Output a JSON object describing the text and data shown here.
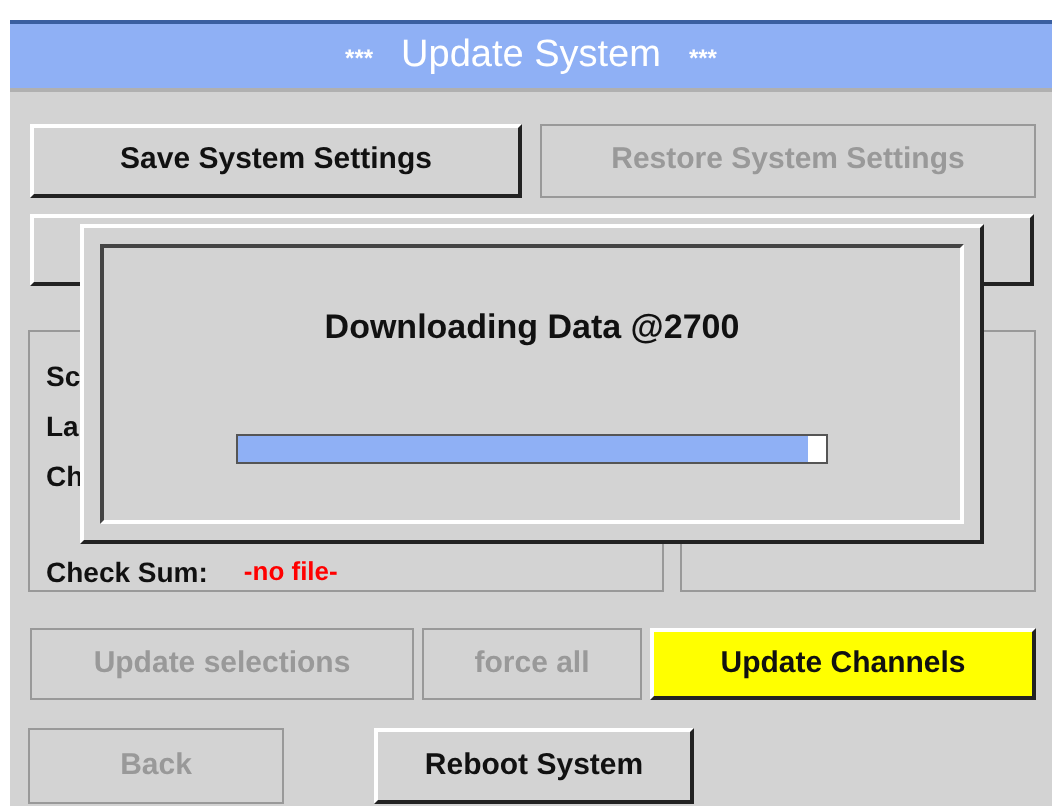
{
  "window": {
    "title": "Update System",
    "title_marks": "***"
  },
  "buttons_top": [
    {
      "label": "Save System Settings",
      "disabled": false
    },
    {
      "label": "Restore System Settings",
      "disabled": true
    }
  ],
  "info_lines": [
    {
      "label": "Sc"
    },
    {
      "label": "La"
    },
    {
      "label": "Ch"
    },
    {
      "label": "Check Sum:",
      "value": "-no file-"
    }
  ],
  "dialog": {
    "message": "Downloading Data @2700",
    "level": 0.97
  },
  "update_buttons": [
    {
      "label": "Update selections",
      "disabled": true,
      "highlighted": false
    },
    {
      "label": "force all",
      "disabled": true,
      "highlighted": false
    },
    {
      "label": "Update Channels",
      "disabled": false,
      "highlighted": true
    }
  ],
  "bottom_buttons": [
    {
      "label": "Back",
      "disabled": true
    },
    {
      "label": "Reboot System",
      "disabled": false
    }
  ]
}
